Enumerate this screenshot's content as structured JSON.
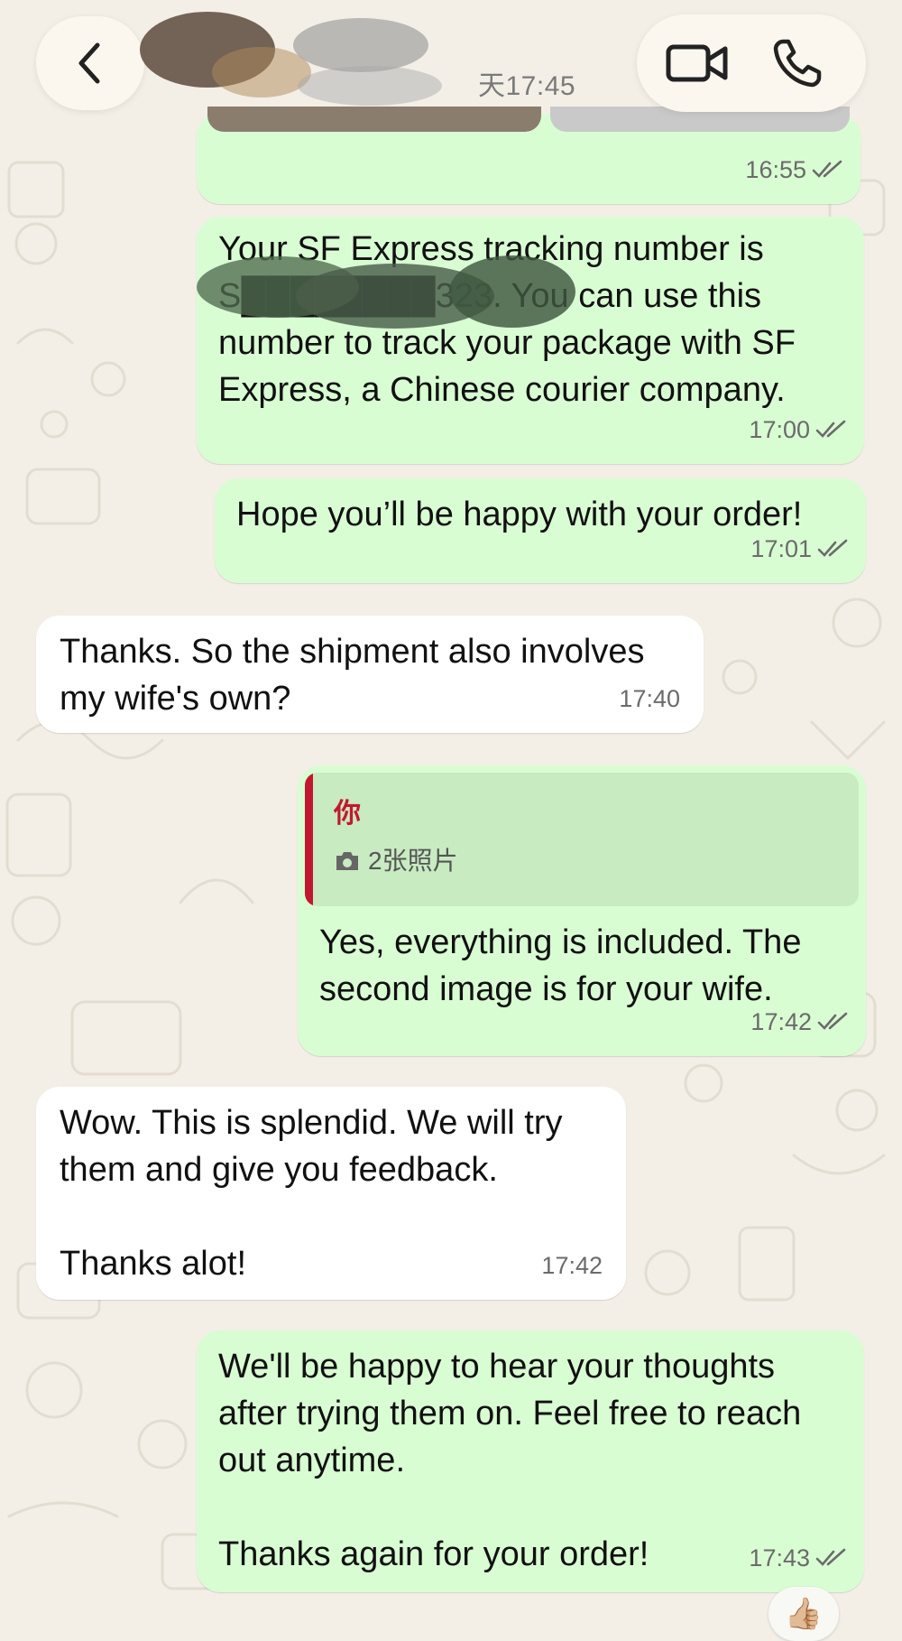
{
  "header": {
    "last_seen": "天17:45",
    "back_icon": "chevron-left-icon",
    "video_icon": "video-camera-icon",
    "phone_icon": "phone-icon"
  },
  "messages": [
    {
      "direction": "out",
      "time": "16:55"
    },
    {
      "direction": "out",
      "text": "Your SF Express tracking number is S████████323. You can use this number to track your package with SF Express, a Chinese courier company.",
      "time": "17:00"
    },
    {
      "direction": "out",
      "text": "Hope you’ll be happy with your order!",
      "time": "17:01"
    },
    {
      "direction": "in",
      "text": "Thanks. So the shipment also involves my wife's own?",
      "time": "17:40"
    },
    {
      "direction": "out",
      "quote_author": "你",
      "quote_preview": "2张照片",
      "text": "Yes, everything is included. The second image is for your wife.",
      "time": "17:42"
    },
    {
      "direction": "in",
      "text": "Wow. This is splendid. We will try them and give you feedback.\n\nThanks alot!",
      "time": "17:42"
    },
    {
      "direction": "out",
      "text": "We'll be happy to hear your thoughts after trying them on. Feel free to reach out anytime.\n\nThanks again for your order!",
      "time": "17:43"
    }
  ],
  "reaction": "👍🏼",
  "colors": {
    "outgoing": "#d9fdd3",
    "incoming": "#ffffff",
    "quote_accent": "#c2182f",
    "background": "#f3efe7"
  }
}
